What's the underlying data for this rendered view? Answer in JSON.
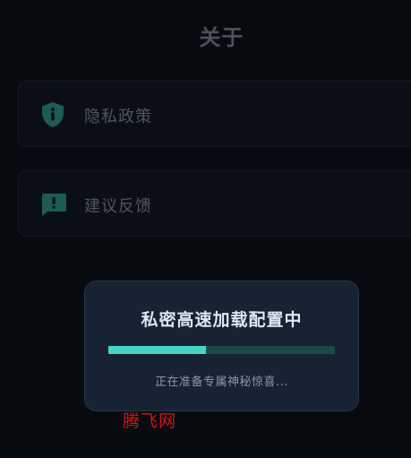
{
  "header": {
    "title": "关于"
  },
  "menu": {
    "items": [
      {
        "label": "隐私政策",
        "icon": "shield-info-icon"
      },
      {
        "label": "建议反馈",
        "icon": "feedback-icon"
      }
    ]
  },
  "loading": {
    "title": "私密高速加载配置中",
    "subtitle": "正在准备专属神秘惊喜...",
    "progress": 0.43
  },
  "watermark": {
    "text": "腾飞网"
  },
  "colors": {
    "background": "#070b10",
    "icon_accent": "#1c5c55",
    "progress_fill": "#45d3c4",
    "progress_track": "#1d4846",
    "card": "#172232",
    "watermark": "#d01515"
  }
}
